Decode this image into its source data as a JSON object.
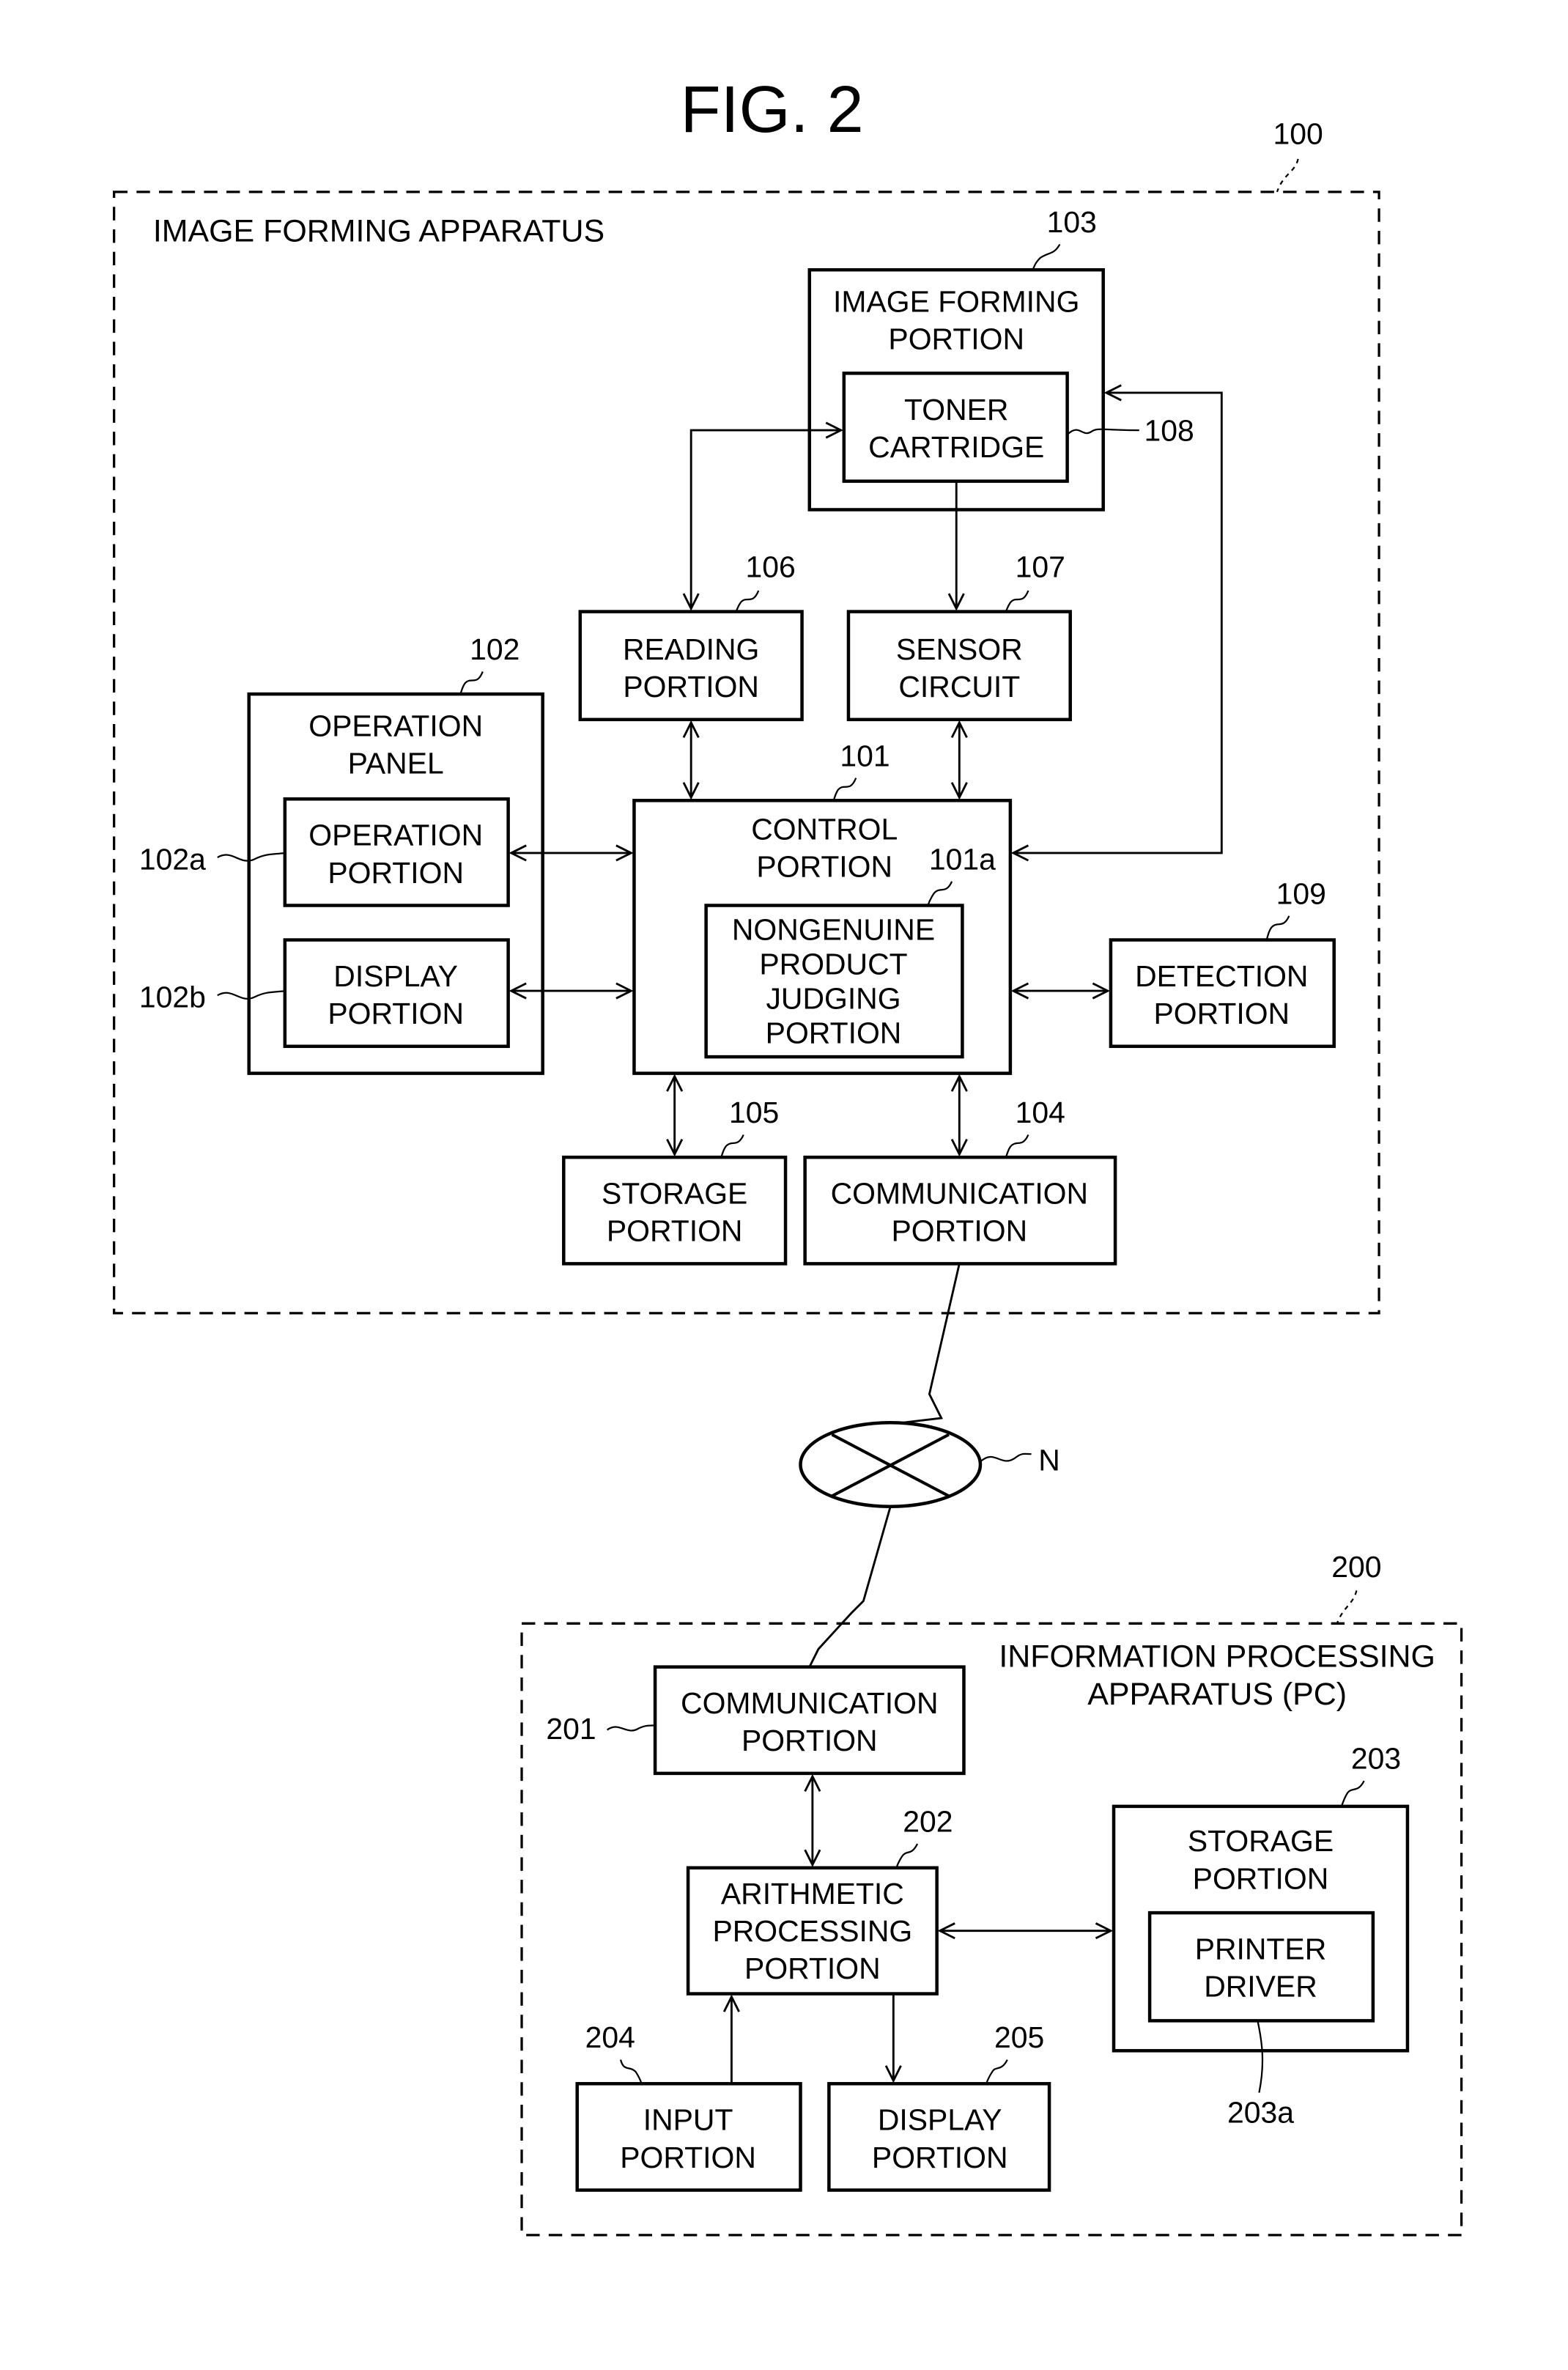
{
  "figure": {
    "title": "FIG. 2"
  },
  "apparatus_100": {
    "ref": "100",
    "label": "IMAGE FORMING APPARATUS",
    "blocks": {
      "image_forming_portion": {
        "ref": "103",
        "lines": [
          "IMAGE FORMING",
          "PORTION"
        ]
      },
      "toner_cartridge": {
        "ref": "108",
        "lines": [
          "TONER",
          "CARTRIDGE"
        ]
      },
      "reading_portion": {
        "ref": "106",
        "lines": [
          "READING",
          "PORTION"
        ]
      },
      "sensor_circuit": {
        "ref": "107",
        "lines": [
          "SENSOR",
          "CIRCUIT"
        ]
      },
      "operation_panel": {
        "ref": "102",
        "lines": [
          "OPERATION",
          "PANEL"
        ]
      },
      "operation_portion": {
        "ref": "102a",
        "lines": [
          "OPERATION",
          "PORTION"
        ]
      },
      "display_portion": {
        "ref": "102b",
        "lines": [
          "DISPLAY",
          "PORTION"
        ]
      },
      "control_portion": {
        "ref": "101",
        "lines": [
          "CONTROL",
          "PORTION"
        ]
      },
      "nongenuine_judging": {
        "ref": "101a",
        "lines": [
          "NONGENUINE",
          "PRODUCT",
          "JUDGING",
          "PORTION"
        ]
      },
      "detection_portion": {
        "ref": "109",
        "lines": [
          "DETECTION",
          "PORTION"
        ]
      },
      "storage_portion": {
        "ref": "105",
        "lines": [
          "STORAGE",
          "PORTION"
        ]
      },
      "communication_portion": {
        "ref": "104",
        "lines": [
          "COMMUNICATION",
          "PORTION"
        ]
      }
    }
  },
  "network": {
    "ref": "N"
  },
  "apparatus_200": {
    "ref": "200",
    "label_lines": [
      "INFORMATION PROCESSING",
      "APPARATUS (PC)"
    ],
    "blocks": {
      "communication_portion": {
        "ref": "201",
        "lines": [
          "COMMUNICATION",
          "PORTION"
        ]
      },
      "arithmetic_processing": {
        "ref": "202",
        "lines": [
          "ARITHMETIC",
          "PROCESSING",
          "PORTION"
        ]
      },
      "storage_portion": {
        "ref": "203",
        "lines": [
          "STORAGE",
          "PORTION"
        ]
      },
      "printer_driver": {
        "ref": "203a",
        "lines": [
          "PRINTER",
          "DRIVER"
        ]
      },
      "input_portion": {
        "ref": "204",
        "lines": [
          "INPUT",
          "PORTION"
        ]
      },
      "display_portion": {
        "ref": "205",
        "lines": [
          "DISPLAY",
          "PORTION"
        ]
      }
    }
  }
}
